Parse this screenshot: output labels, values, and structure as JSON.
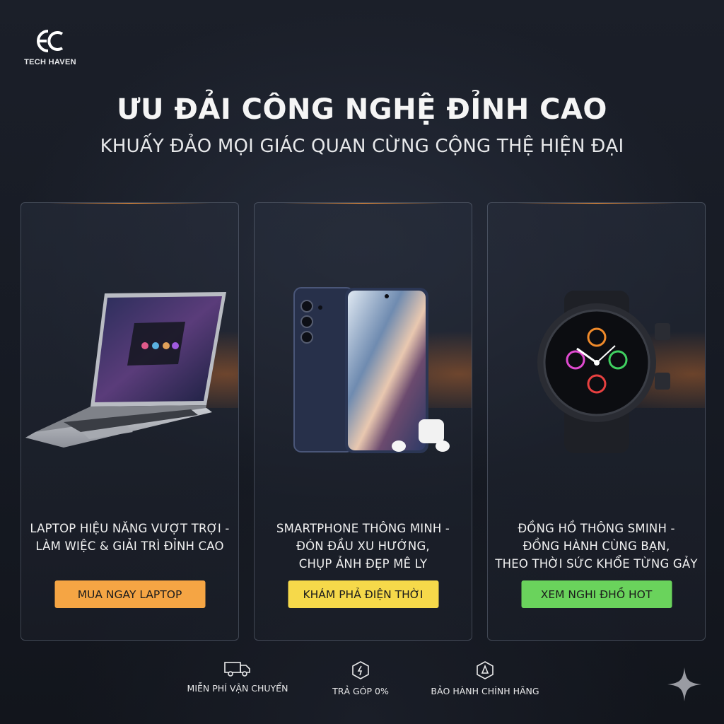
{
  "brand": {
    "logo_text": "EC",
    "name": "TECH HAVEN"
  },
  "hero": {
    "title": "ƯU ĐẢI CÔNG NGHỆ ĐỈNH CAO",
    "subtitle": "KHUẤY ĐẢO MỌI GIÁC QUAN CỪNG CỘNG THỆ HIỆN ĐẠI"
  },
  "cards": [
    {
      "product_icon": "laptop-icon",
      "lines": [
        "LAPTOP HIỆU NĂNG VƯỢT TRỢI -",
        "LÀM WIỆC & GIẢI TRÌ ĐỈNH CAO"
      ],
      "button": "MUA NGAY LAPTOP",
      "button_color": "#f5a544"
    },
    {
      "product_icon": "smartphone-icon",
      "lines": [
        "SMARTPHONE THÔNG MINH -",
        "ĐÓN ĐẦU XU HƯỚNG,",
        "CHỤP ẢNH ĐẸP MÊ LY"
      ],
      "button": "KHÁM PHẢ ĐIỆN THỜI",
      "button_color": "#f6d94a"
    },
    {
      "product_icon": "smartwatch-icon",
      "lines": [
        "ĐỒNG HỒ THÔNG SMINH -",
        "ĐỒNG HÀNH CÙNG BẠN,",
        "THEO THỜI SỨC KHỔE TỪNG GẢY"
      ],
      "button": "XEM NGHI ĐHỒ HOT",
      "button_color": "#6ad35c"
    }
  ],
  "features": [
    {
      "icon": "truck-icon",
      "label": "MIỄN PHÍ VẬN CHUYỂN"
    },
    {
      "icon": "installment-icon",
      "label": "TRẢ GÓP 0%"
    },
    {
      "icon": "warranty-icon",
      "label": "BẢO HÀNH CHÍNH HÃNG"
    }
  ],
  "colors": {
    "accent_orange": "#ff9a3d",
    "background": "#1b1f29"
  }
}
